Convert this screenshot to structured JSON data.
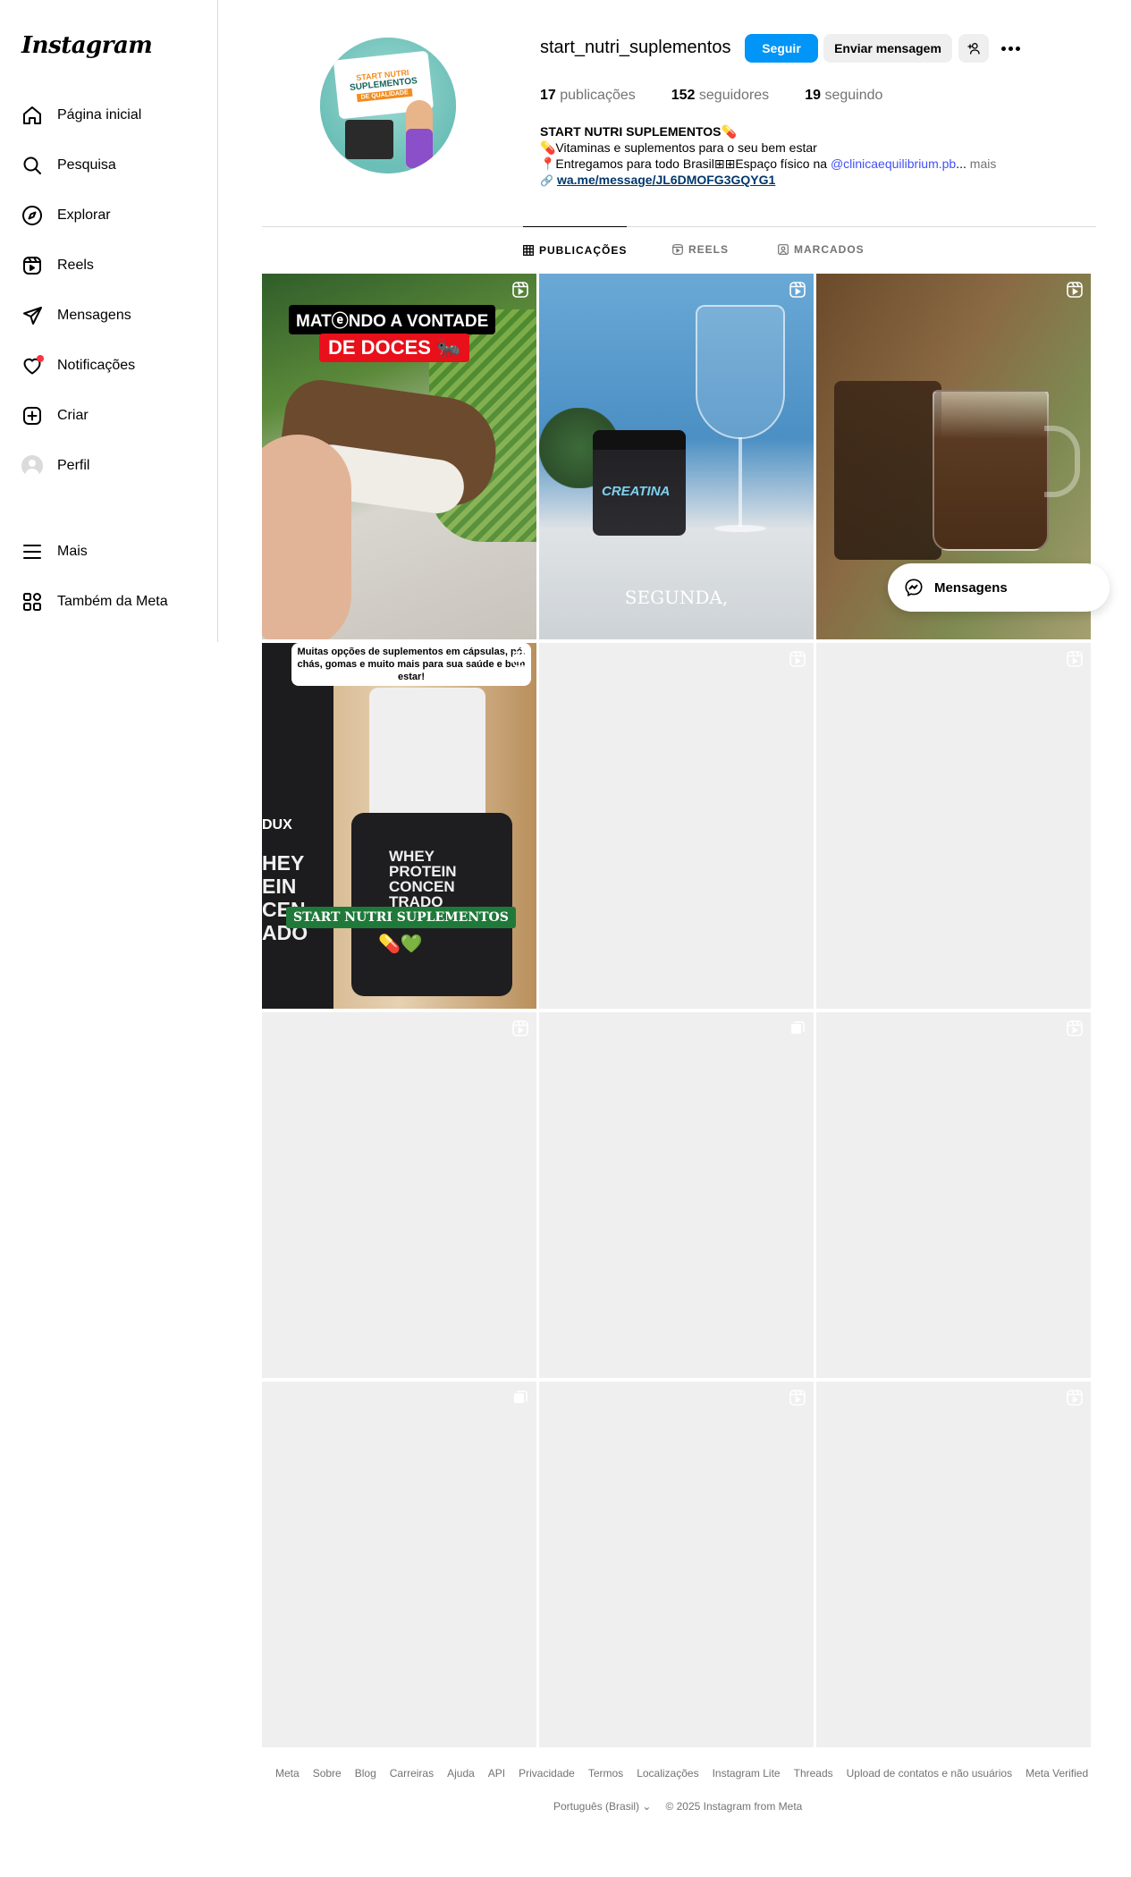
{
  "app": {
    "logo": "Instagram"
  },
  "sidebar": {
    "items": [
      {
        "label": "Página inicial",
        "icon": "home-icon"
      },
      {
        "label": "Pesquisa",
        "icon": "search-icon"
      },
      {
        "label": "Explorar",
        "icon": "compass-icon"
      },
      {
        "label": "Reels",
        "icon": "reels-icon"
      },
      {
        "label": "Mensagens",
        "icon": "send-icon"
      },
      {
        "label": "Notificações",
        "icon": "heart-icon"
      },
      {
        "label": "Criar",
        "icon": "plus-square-icon"
      },
      {
        "label": "Perfil",
        "icon": "avatar"
      }
    ],
    "more": "Mais",
    "meta": "Também da Meta"
  },
  "profile": {
    "username": "start_nutri_suplementos",
    "follow": "Seguir",
    "message": "Enviar mensagem",
    "stats": {
      "posts_count": "17",
      "posts_label": "publicações",
      "followers_count": "152",
      "followers_label": "seguidores",
      "following_count": "19",
      "following_label": "seguindo"
    },
    "picture_text": {
      "line1": "START NUTRI",
      "line2": "SUPLEMENTOS",
      "line3": "DE QUALIDADE"
    },
    "bio": {
      "name": "START NUTRI SUPLEMENTOS💊",
      "line1": "💊Vitaminas e suplementos para o seu bem estar",
      "line2_prefix": "📍Entregamos para todo Brasil⊞⊞Espaço físico na ",
      "line2_mention": "@clinicaequilibrium.pb",
      "line2_ellipsis": "...",
      "more": "mais",
      "link": "wa.me/message/JL6DMOFG3GQYG1"
    }
  },
  "tabs": [
    {
      "label": "PUBLICAÇÕES",
      "active": true
    },
    {
      "label": "REELS",
      "active": false
    },
    {
      "label": "MARCADOS",
      "active": false
    }
  ],
  "posts": {
    "p1": {
      "caption1": "MATⓔNDO A VONTADE",
      "caption2": "DE DOCES 🐜"
    },
    "p2": {
      "label": "CREATINA",
      "caption": "SEGUNDA,"
    },
    "p4": {
      "top": "Muitas opções de suplementos em cápsulas, pó, chás, gomas e muito mais para sua saúde e bem estar!",
      "brand": "DUX",
      "left_text": "HEY\nEIN\nCEN\nADO",
      "jar_text": "WHEY\nPROTEIN\nCONCEN\nTRADO",
      "bottom": "START NUTRI SUPLEMENTOS",
      "emoji": "💊💚"
    }
  },
  "floating": {
    "messages": "Mensagens"
  },
  "footer": {
    "links": [
      "Meta",
      "Sobre",
      "Blog",
      "Carreiras",
      "Ajuda",
      "API",
      "Privacidade",
      "Termos",
      "Localizações",
      "Instagram Lite",
      "Threads",
      "Upload de contatos e não usuários",
      "Meta Verified"
    ],
    "language": "Português (Brasil)",
    "copyright": "© 2025 Instagram from Meta"
  },
  "colors": {
    "primary": "#0095f6",
    "mention": "#4150f7",
    "notification": "#ff3040",
    "placeholder": "#efefef"
  }
}
